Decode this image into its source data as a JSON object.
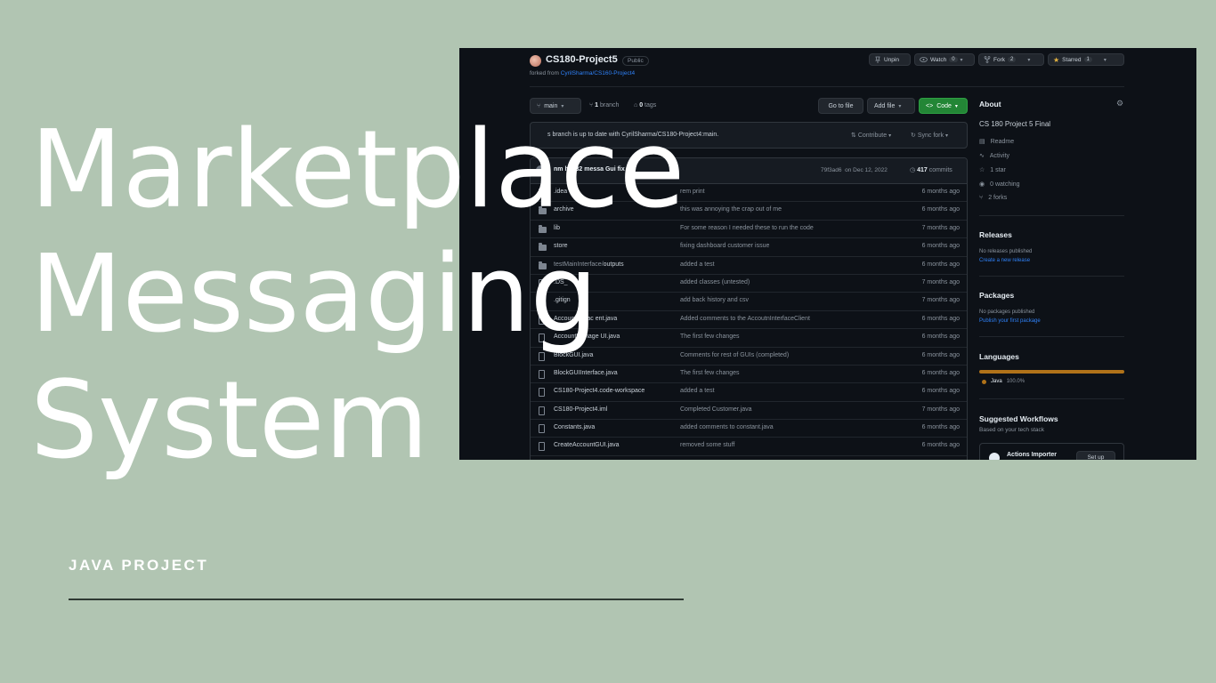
{
  "hero": {
    "line1": "Marketplace",
    "line2": "Messaging",
    "line3": "System",
    "subtitle": "JAVA PROJECT"
  },
  "repo": {
    "name": "CS180-Project5",
    "visibility": "Public",
    "forked_prefix": "forked from ",
    "forked_link": "CyrilSharma/CS160-Project4",
    "unpin": "Unpin",
    "watch": "Watch",
    "watch_count": "0",
    "fork": "Fork",
    "fork_count": "2",
    "starred": "Starred",
    "star_count": "1"
  },
  "toolbar": {
    "branch": "main",
    "branches_count": "1",
    "branches_label": "branch",
    "tags_count": "0",
    "tags_label": "tags",
    "go_to_file": "Go to file",
    "add_file": "Add file",
    "code": "Code"
  },
  "notice": {
    "text": "s branch is up to date with CyrilSharma/CS180-Project4:main.",
    "contribute": "Contribute",
    "sync_fork": "Sync fork"
  },
  "commit": {
    "author_msg": "nm         hy932 messa    Gui fix",
    "hash": "79f3ad6",
    "date": "on Dec 12, 2022",
    "count": "417",
    "count_label": "commits"
  },
  "files": [
    {
      "type": "folder",
      "name": ".idea",
      "msg": "rem      print",
      "time": "6 months ago"
    },
    {
      "type": "folder",
      "name": "archive",
      "msg": "this was annoying the crap out of me",
      "time": "6 months ago"
    },
    {
      "type": "folder",
      "name": "lib",
      "msg": "For some reason I needed these to run the code",
      "time": "7 months ago"
    },
    {
      "type": "folder",
      "name": "store",
      "msg": "fixing dashboard customer issue",
      "time": "6 months ago"
    },
    {
      "type": "folder",
      "name_dim": "testMainInterface/",
      "name": "outputs",
      "msg": "added a test",
      "time": "6 months ago"
    },
    {
      "type": "file",
      "name": ".DS_      ",
      "msg": "added classes (untested)",
      "time": "7 months ago"
    },
    {
      "type": "file",
      "name": ".gitign   ",
      "msg": "add back history and csv",
      "time": "7 months ago"
    },
    {
      "type": "file",
      "name": "Account    terfac          ent.java",
      "msg": "Added comments to the AccoutnInterfaceClient",
      "time": "6 months ago"
    },
    {
      "type": "file",
      "name": "AccountManage       UI.java",
      "msg": "The first few changes",
      "time": "6 months ago"
    },
    {
      "type": "file",
      "name": "BlockGUI.java",
      "msg": "Comments for rest of GUIs (completed)",
      "time": "6 months ago"
    },
    {
      "type": "file",
      "name": "BlockGUIInterface.java",
      "msg": "The first few changes",
      "time": "6 months ago"
    },
    {
      "type": "file",
      "name": "CS180-Project4.code-workspace",
      "msg": "added a test",
      "time": "6 months ago"
    },
    {
      "type": "file",
      "name": "CS180-Project4.iml",
      "msg": "Completed Customer.java",
      "time": "7 months ago"
    },
    {
      "type": "file",
      "name": "Constants.java",
      "msg": "added comments to constant.java",
      "time": "6 months ago"
    },
    {
      "type": "file",
      "name": "CreateAccountGUI.java",
      "msg": "removed some stuff",
      "time": "6 months ago"
    }
  ],
  "sidebar": {
    "about": "About",
    "description": "CS 180 Project 5 Final",
    "readme": "Readme",
    "activity": "Activity",
    "stars": "1 star",
    "watching": "0 watching",
    "forks": "2 forks",
    "releases": "Releases",
    "no_releases": "No releases published",
    "create_release": "Create a new release",
    "packages": "Packages",
    "no_packages": "No packages published",
    "publish_package": "Publish your first package",
    "languages": "Languages",
    "java": "Java",
    "java_pct": "100.0%",
    "suggested": "Suggested Workflows",
    "based_on": "Based on your tech stack",
    "actions_importer": "Actions Importer",
    "set_up": "Set up"
  }
}
